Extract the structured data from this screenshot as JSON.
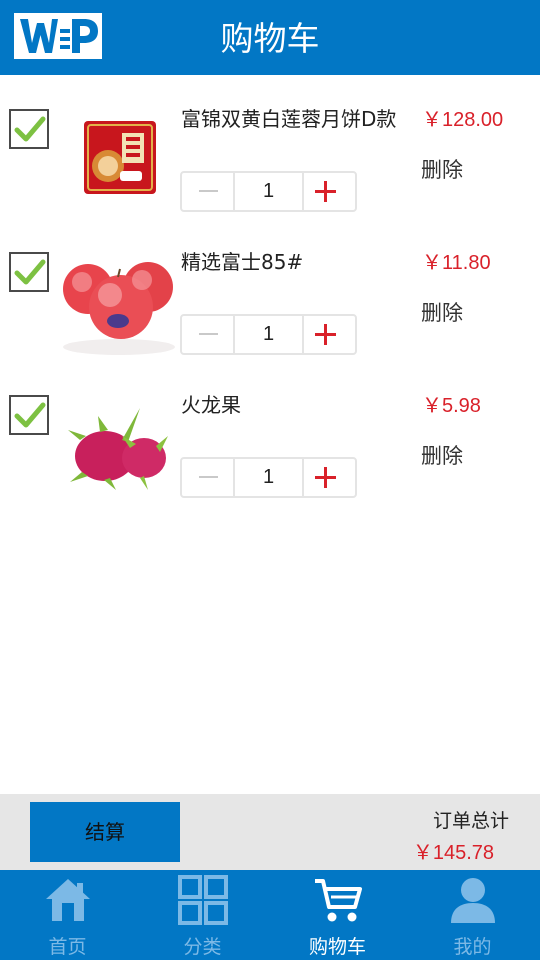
{
  "header": {
    "title": "购物车"
  },
  "cart": {
    "items": [
      {
        "name": "富锦双黄白莲蓉月饼D款",
        "price": "￥128.00",
        "quantity": "1",
        "delete_label": "删除",
        "checked": true,
        "image": "mooncake-box"
      },
      {
        "name": "精选富士85#",
        "price": "￥11.80",
        "quantity": "1",
        "delete_label": "删除",
        "checked": true,
        "image": "red-apples"
      },
      {
        "name": "火龙果",
        "price": "￥5.98",
        "quantity": "1",
        "delete_label": "删除",
        "checked": true,
        "image": "dragon-fruit"
      }
    ]
  },
  "summary": {
    "checkout_label": "结算",
    "total_label": "订单总计",
    "total_value": "￥145.78"
  },
  "tabbar": {
    "tabs": [
      {
        "label": "首页",
        "icon": "home-icon",
        "active": false
      },
      {
        "label": "分类",
        "icon": "grid-icon",
        "active": false
      },
      {
        "label": "购物车",
        "icon": "cart-icon",
        "active": true
      },
      {
        "label": "我的",
        "icon": "user-icon",
        "active": false
      }
    ]
  },
  "colors": {
    "brand": "#0277c5",
    "price": "#d9212a",
    "check": "#7dc142"
  }
}
